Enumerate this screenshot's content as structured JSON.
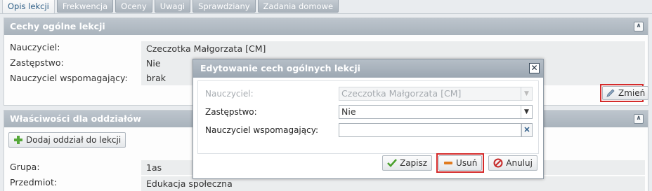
{
  "tabs": [
    "Opis lekcji",
    "Frekwencja",
    "Oceny",
    "Uwagi",
    "Sprawdziany",
    "Zadania domowe"
  ],
  "general_panel": {
    "title": "Cechy ogólne lekcji",
    "rows": [
      {
        "label": "Nauczyciel:",
        "value": "Czeczotka Małgorzata [CM]"
      },
      {
        "label": "Zastępstwo:",
        "value": "Nie"
      },
      {
        "label": "Nauczyciel wspomagający:",
        "value": "brak"
      }
    ],
    "change_button": "Zmień",
    "collapse_icon": "double-chevron-up-icon"
  },
  "classes_panel": {
    "title": "Właściwości dla oddziałów",
    "add_button": "Dodaj oddział do lekcji",
    "rows": [
      {
        "label": "Grupa:",
        "value": "1as"
      },
      {
        "label": "Przedmiot:",
        "value": "Edukacja społeczna"
      }
    ]
  },
  "modal": {
    "title": "Edytowanie cech ogólnych lekcji",
    "fields": [
      {
        "label": "Nauczyciel:",
        "value": "Czeczotka Małgorzata [CM]",
        "disabled": true
      },
      {
        "label": "Zastępstwo:",
        "value": "Nie",
        "disabled": false
      },
      {
        "label": "Nauczyciel wspomagający:",
        "value": "",
        "disabled": false
      }
    ],
    "buttons": {
      "save": "Zapisz",
      "delete": "Usuń",
      "cancel": "Anuluj"
    }
  },
  "colors": {
    "accent_red": "#d42b2b",
    "header": "#a9b3bc",
    "save_green": "#4aa02c",
    "delete_orange": "#e07b1f",
    "cancel_red": "#c62828"
  }
}
